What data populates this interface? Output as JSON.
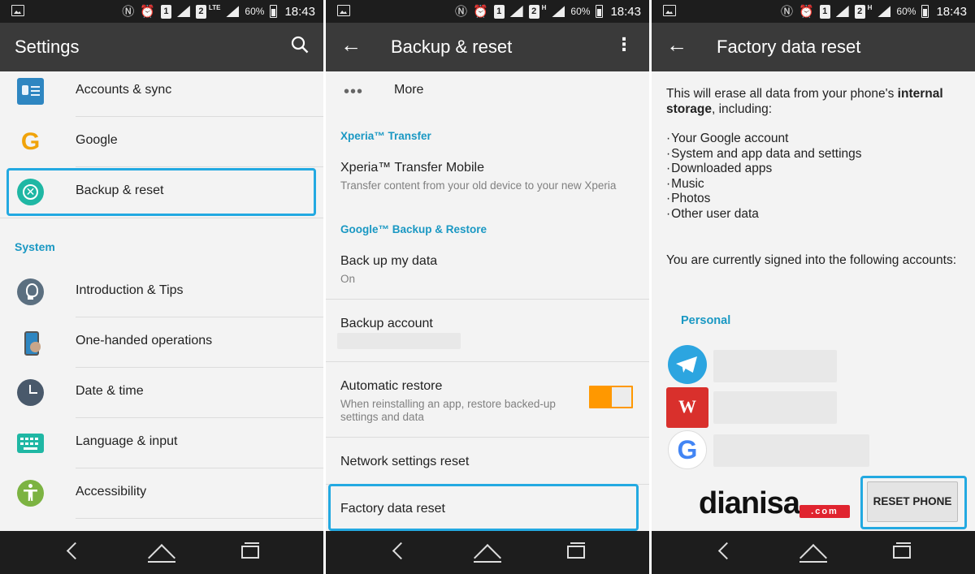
{
  "status_bar": {
    "battery": "60%",
    "time": "18:43",
    "sim1": "1",
    "sim2": "2",
    "network1": "LTE",
    "network2": "H"
  },
  "screen1": {
    "title": "Settings",
    "items_top": [
      {
        "label": "Accounts & sync",
        "icon": "accounts-icon"
      },
      {
        "label": "Google",
        "icon": "google-icon"
      },
      {
        "label": "Backup & reset",
        "icon": "backup-reset-icon"
      }
    ],
    "section": "System",
    "items_system": [
      {
        "label": "Introduction & Tips",
        "icon": "lightbulb-icon"
      },
      {
        "label": "One-handed operations",
        "icon": "phone-hand-icon"
      },
      {
        "label": "Date & time",
        "icon": "clock-icon"
      },
      {
        "label": "Language & input",
        "icon": "keyboard-icon"
      },
      {
        "label": "Accessibility",
        "icon": "accessibility-icon"
      }
    ],
    "google_letter": "G"
  },
  "screen2": {
    "title": "Backup & reset",
    "more_label": "More",
    "more_dots": "•••",
    "cat_xperia": "Xperia™ Transfer",
    "xperia_title": "Xperia™ Transfer Mobile",
    "xperia_sub": "Transfer content from your old device to your new Xperia",
    "cat_google": "Google™ Backup & Restore",
    "backup_title": "Back up my data",
    "backup_sub": "On",
    "account_title": "Backup account",
    "auto_title": "Automatic restore",
    "auto_sub": "When reinstalling an app, restore backed-up settings and data",
    "auto_on": true,
    "network_title": "Network settings reset",
    "factory_title": "Factory data reset"
  },
  "screen3": {
    "title": "Factory data reset",
    "intro_pre": "This will erase all data from your phone's ",
    "intro_bold": "internal storage",
    "intro_post": ", including:",
    "items": [
      "Your Google account",
      "System and app data and settings",
      "Downloaded apps",
      "Music",
      "Photos",
      "Other user data"
    ],
    "signed_text": "You are currently signed into the following accounts:",
    "personal": "Personal",
    "wps_letter": "W",
    "google_letter": "G",
    "reset_button": "RESET PHONE",
    "watermark_main": "dianisa",
    "watermark_com": ".com"
  },
  "colors": {
    "accent": "#1a98c3",
    "highlight": "#23a9e1",
    "toggle": "#ff9800",
    "appbar": "#3a3a3a"
  }
}
